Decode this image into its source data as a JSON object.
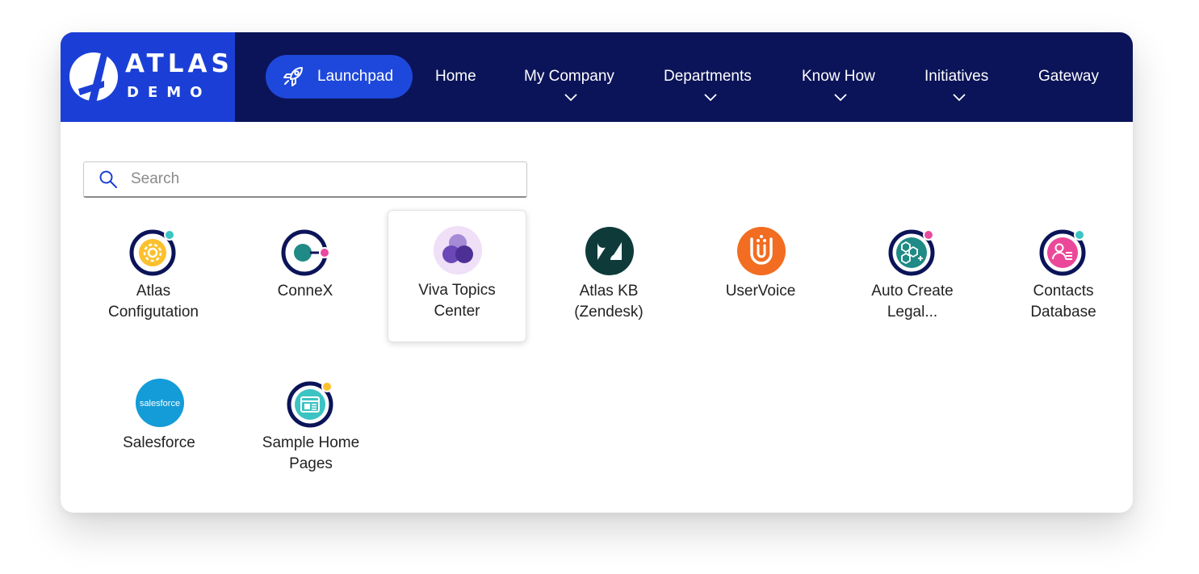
{
  "brand": {
    "name": "ATLAS",
    "sub": "DEMO"
  },
  "nav": {
    "launchpad": "Launchpad",
    "items": [
      {
        "label": "Home"
      },
      {
        "label": "My Company"
      },
      {
        "label": "Departments"
      },
      {
        "label": "Know How"
      },
      {
        "label": "Initiatives"
      },
      {
        "label": "Gateway"
      }
    ]
  },
  "search": {
    "placeholder": "Search",
    "value": ""
  },
  "apps": [
    {
      "label_lines": [
        "Atlas",
        "Configutation"
      ],
      "icon": "gear-icon"
    },
    {
      "label_lines": [
        "ConneX",
        ""
      ],
      "icon": "connex-icon"
    },
    {
      "label_lines": [
        "Viva Topics",
        "Center"
      ],
      "icon": "viva-topics-icon"
    },
    {
      "label_lines": [
        "Atlas KB",
        "(Zendesk)"
      ],
      "icon": "zendesk-icon"
    },
    {
      "label_lines": [
        "UserVoice",
        ""
      ],
      "icon": "uservoice-icon"
    },
    {
      "label_lines": [
        "Auto Create",
        "Legal..."
      ],
      "icon": "hexagons-icon"
    },
    {
      "label_lines": [
        "Contacts",
        "Database"
      ],
      "icon": "contacts-icon"
    },
    {
      "label_lines": [
        "Salesforce",
        ""
      ],
      "icon": "salesforce-icon",
      "logo_text": "salesforce"
    },
    {
      "label_lines": [
        "Sample Home",
        "Pages"
      ],
      "icon": "web-page-icon"
    }
  ],
  "colors": {
    "nav_bg": "#0b1458",
    "brand_bg": "#1b3fd6",
    "pill": "#1e48db",
    "ring": "#0b1458",
    "teal_dot": "#3cc3c3",
    "pink_dot": "#e94ba0"
  }
}
